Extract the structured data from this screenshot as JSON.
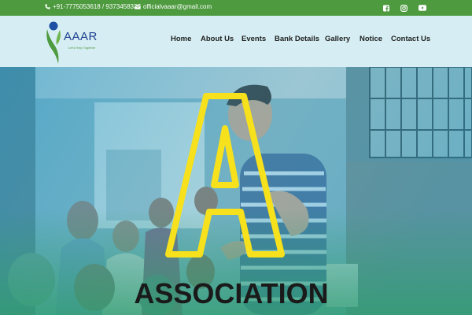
{
  "topbar": {
    "phone_icon": "phone-icon",
    "phone": "+91-7775053618 / 9373458337",
    "email_icon": "envelope-icon",
    "email": "officialvaaar@gmail.com",
    "social": [
      "facebook-icon",
      "instagram-icon",
      "youtube-icon"
    ]
  },
  "logo": {
    "name": "AAAR",
    "tagline": "Let's Help Together"
  },
  "nav": {
    "items": [
      {
        "label": "Home"
      },
      {
        "label": "About Us"
      },
      {
        "label": "Events"
      },
      {
        "label": "Bank Details"
      },
      {
        "label": "Gallery"
      },
      {
        "label": "Notice"
      },
      {
        "label": "Contact Us"
      }
    ]
  },
  "hero": {
    "big_letter": "A",
    "caption": "ASSOCIATION"
  },
  "colors": {
    "topbar_bg": "#4d9a3f",
    "navbar_bg": "#d6eef3",
    "logo_blue": "#1c3f8f",
    "accent_yellow": "#f6e11c"
  }
}
